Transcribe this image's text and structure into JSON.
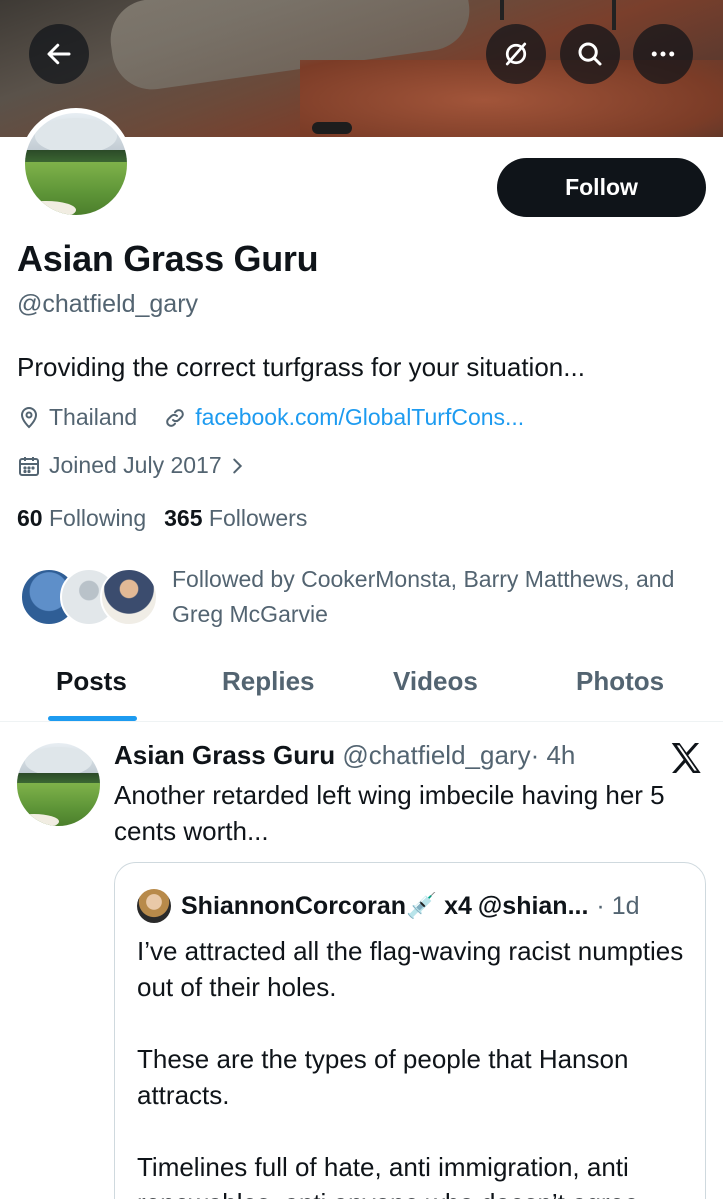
{
  "header": {
    "back_icon": "arrow-left-icon",
    "grok_icon": "grok-slash-icon",
    "search_icon": "search-icon",
    "more_icon": "more-dots-icon"
  },
  "profile": {
    "name": "Asian Grass Guru",
    "handle": "@chatfield_gary",
    "follow_label": "Follow",
    "bio": "Providing the correct turfgrass for your situation...",
    "location": "Thailand",
    "website": "facebook.com/GlobalTurfCons...",
    "joined": "Joined July 2017",
    "following_count": "60",
    "following_label": "Following",
    "followers_count": "365",
    "followers_label": "Followers",
    "followed_by": "Followed by CookerMonsta, Barry Matthews, and Greg McGarvie"
  },
  "tabs": [
    {
      "label": "Posts",
      "active": true
    },
    {
      "label": "Replies",
      "active": false
    },
    {
      "label": "Videos",
      "active": false
    },
    {
      "label": "Photos",
      "active": false
    }
  ],
  "post": {
    "author_name": "Asian Grass Guru",
    "author_handle": "@chatfield_gary",
    "time": "· 4h",
    "text": "Another retarded left wing imbecile having her 5 cents worth...",
    "quote": {
      "name": "ShiannonCorcoran💉 x4",
      "handle": "@shian...",
      "time": "· 1d",
      "text": "I’ve attracted all the flag-waving racist numpties out of their holes.\n\nThese are the types of people that Hanson attracts.\n\nTimelines full of hate, anti immigration, anti renewables, anti anyone who doesn’t agree"
    }
  },
  "colors": {
    "accent": "#1d9bf0",
    "text_primary": "#0f1419",
    "text_secondary": "#536471",
    "follow_bg": "#0f1419"
  }
}
